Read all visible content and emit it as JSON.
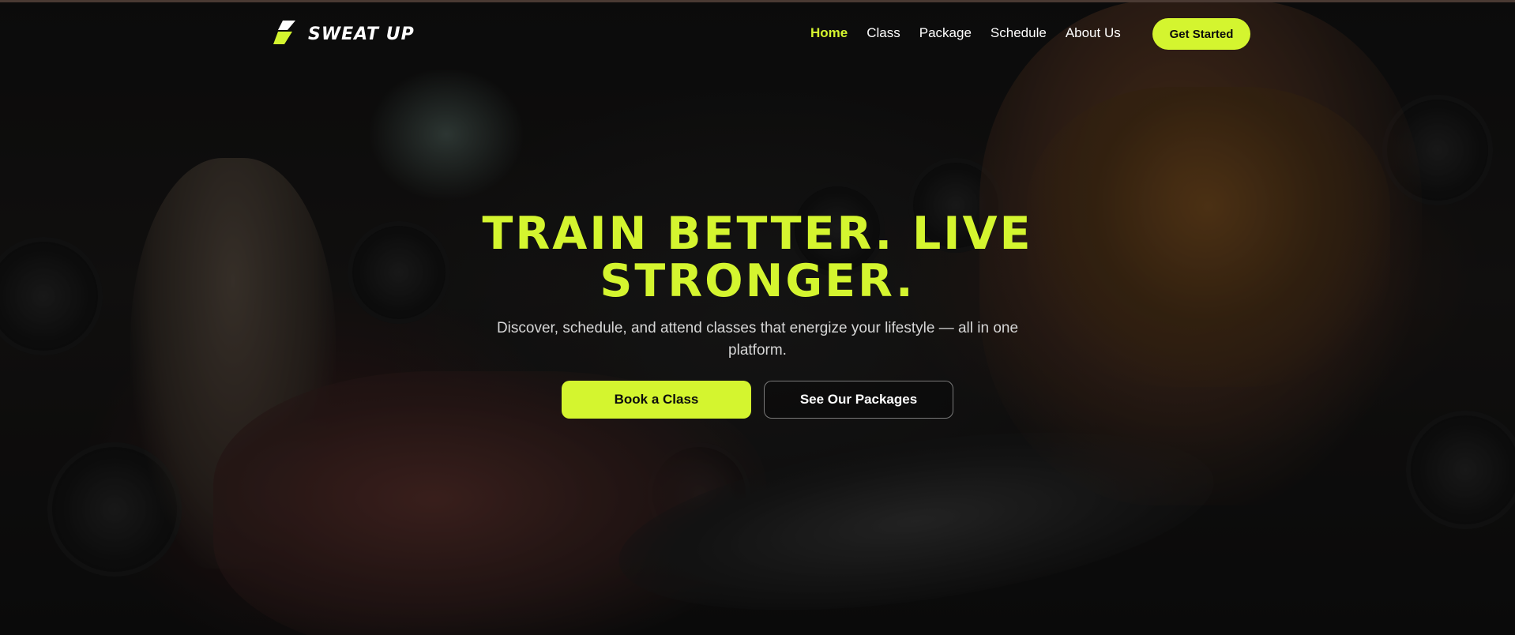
{
  "brand": {
    "name": "SWEAT UP",
    "accent_color": "#d4f52f",
    "logo_icon": "bolt-logo-icon"
  },
  "nav": {
    "links": [
      {
        "label": "Home",
        "active": true
      },
      {
        "label": "Class",
        "active": false
      },
      {
        "label": "Package",
        "active": false
      },
      {
        "label": "Schedule",
        "active": false
      },
      {
        "label": "About Us",
        "active": false
      }
    ],
    "cta_label": "Get Started"
  },
  "hero": {
    "title": "TRAIN BETTER. LIVE STRONGER.",
    "subtitle": "Discover, schedule, and attend classes that energize your lifestyle — all in one platform.",
    "primary_button": "Book a Class",
    "secondary_button": "See Our Packages"
  }
}
